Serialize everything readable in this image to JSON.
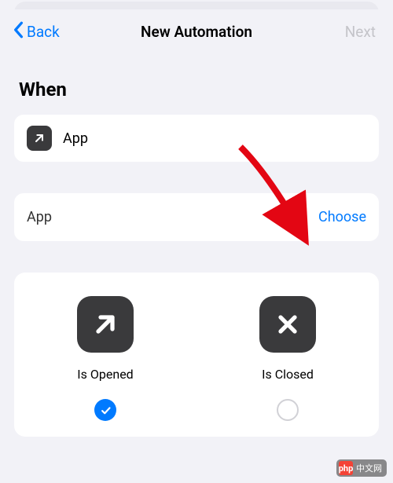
{
  "nav": {
    "back_label": "Back",
    "title": "New Automation",
    "next_label": "Next"
  },
  "section_title": "When",
  "trigger": {
    "icon_name": "arrow-up-right-icon",
    "label": "App"
  },
  "selector": {
    "label": "App",
    "action": "Choose"
  },
  "options": {
    "opened": {
      "icon_name": "arrow-up-right-icon",
      "label": "Is Opened",
      "selected": true
    },
    "closed": {
      "icon_name": "x-icon",
      "label": "Is Closed",
      "selected": false
    }
  },
  "watermark": {
    "logo": "php",
    "text": "中文网"
  }
}
